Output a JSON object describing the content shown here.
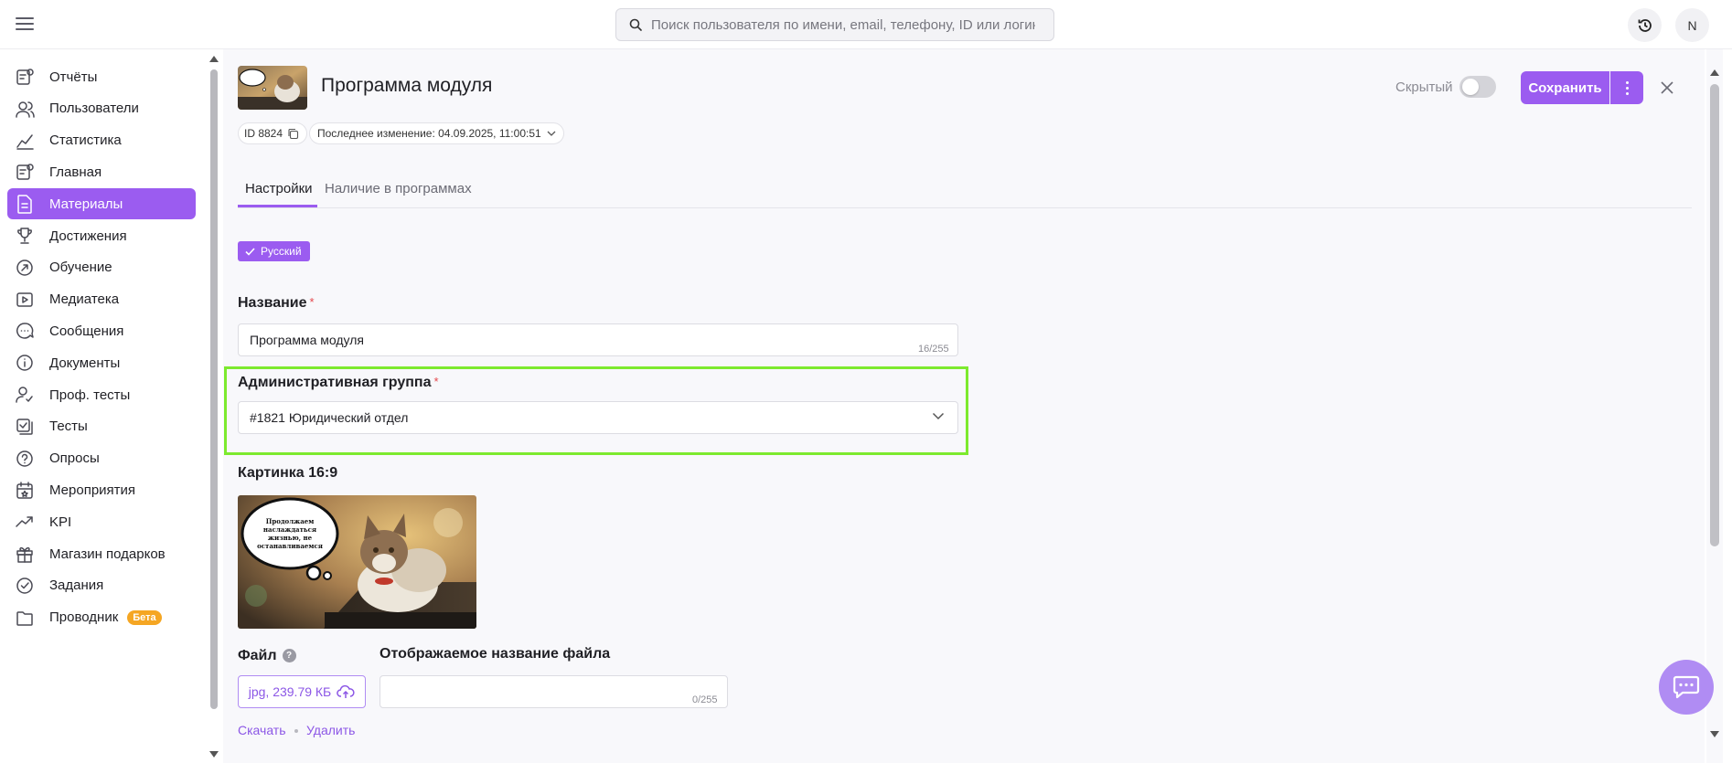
{
  "header": {
    "search_placeholder": "Поиск пользователя по имени, email, телефону, ID или логину",
    "avatar_initial": "N"
  },
  "sidebar": {
    "items": [
      {
        "label": "Отчёты",
        "icon": "report-icon"
      },
      {
        "label": "Пользователи",
        "icon": "users-icon"
      },
      {
        "label": "Статистика",
        "icon": "chart-icon"
      },
      {
        "label": "Главная",
        "icon": "home-icon"
      },
      {
        "label": "Материалы",
        "icon": "document-icon",
        "active": true
      },
      {
        "label": "Достижения",
        "icon": "trophy-icon"
      },
      {
        "label": "Обучение",
        "icon": "learning-icon"
      },
      {
        "label": "Медиатека",
        "icon": "media-icon"
      },
      {
        "label": "Сообщения",
        "icon": "messages-icon"
      },
      {
        "label": "Документы",
        "icon": "info-icon"
      },
      {
        "label": "Проф. тесты",
        "icon": "prof-test-icon"
      },
      {
        "label": "Тесты",
        "icon": "tests-icon"
      },
      {
        "label": "Опросы",
        "icon": "survey-icon"
      },
      {
        "label": "Мероприятия",
        "icon": "calendar-icon"
      },
      {
        "label": "KPI",
        "icon": "trend-icon"
      },
      {
        "label": "Магазин подарков",
        "icon": "gift-icon"
      },
      {
        "label": "Задания",
        "icon": "task-icon"
      },
      {
        "label": "Проводник",
        "icon": "folder-icon",
        "badge": "Бета"
      }
    ]
  },
  "page": {
    "title": "Программа модуля",
    "hidden_label": "Скрытый",
    "hidden_toggle_on": false,
    "save_label": "Сохранить",
    "id_label": "ID 8824",
    "last_modified": "Последнее изменение: 04.09.2025, 11:00:51"
  },
  "tabs": [
    {
      "label": "Настройки",
      "active": true
    },
    {
      "label": "Наличие в программах",
      "active": false
    }
  ],
  "form": {
    "language_chip": "Русский",
    "name_label": "Название",
    "name_value": "Программа модуля",
    "name_counter": "16/255",
    "group_label": "Административная группа",
    "group_value": "#1821 Юридический отдел",
    "cover_label": "Картинка 16:9",
    "cover_bubble_text": "Продолжаем наслаждаться жизнью, не останавливаемся",
    "file_label": "Файл",
    "file_help": "?",
    "file_value": "jpg, 239.79 КБ",
    "file_display_label": "Отображаемое название файла",
    "file_display_value": "",
    "file_display_counter": "0/255",
    "required_mark": "*",
    "download_label": "Скачать",
    "delete_label": "Удалить"
  },
  "colors": {
    "accent": "#9b5cf0",
    "highlight": "#7dea2e",
    "required": "#e5484d",
    "badge": "#f5a623"
  }
}
